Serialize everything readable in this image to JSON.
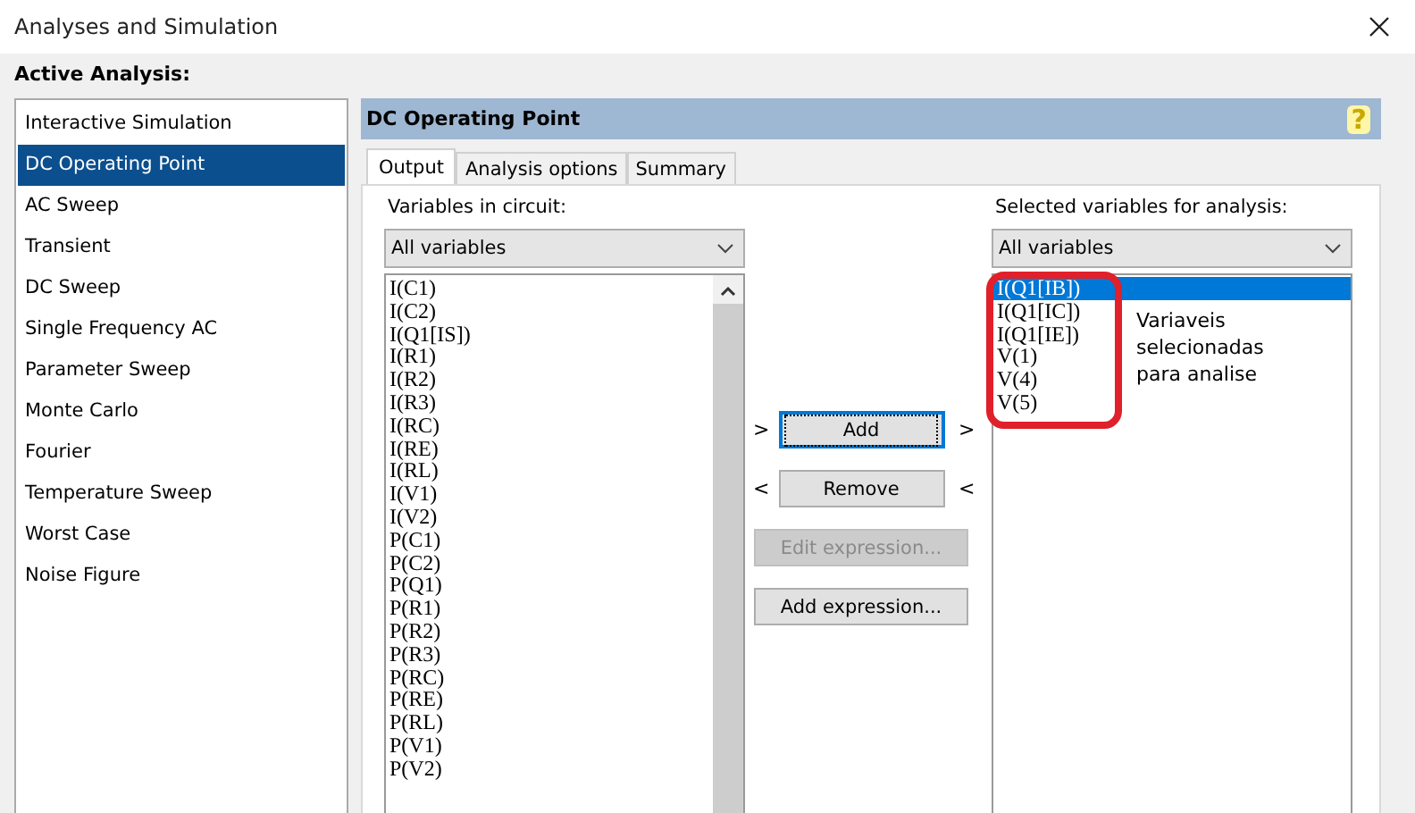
{
  "window": {
    "title": "Analyses and Simulation"
  },
  "active_analysis": {
    "label": "Active Analysis:",
    "items": [
      {
        "label": "Interactive Simulation",
        "selected": false
      },
      {
        "label": "DC Operating Point",
        "selected": true
      },
      {
        "label": "AC Sweep",
        "selected": false
      },
      {
        "label": "Transient",
        "selected": false
      },
      {
        "label": "DC Sweep",
        "selected": false
      },
      {
        "label": "Single Frequency AC",
        "selected": false
      },
      {
        "label": "Parameter Sweep",
        "selected": false
      },
      {
        "label": "Monte Carlo",
        "selected": false
      },
      {
        "label": "Fourier",
        "selected": false
      },
      {
        "label": "Temperature Sweep",
        "selected": false
      },
      {
        "label": "Worst Case",
        "selected": false
      },
      {
        "label": "Noise Figure",
        "selected": false
      }
    ]
  },
  "panel": {
    "title": "DC Operating Point",
    "help": "?"
  },
  "tabs": [
    {
      "label": "Output",
      "selected": true
    },
    {
      "label": "Analysis options",
      "selected": false
    },
    {
      "label": "Summary",
      "selected": false
    }
  ],
  "variables_in_circuit": {
    "label": "Variables in circuit:",
    "filter": "All variables",
    "items": [
      {
        "label": "I(C1)",
        "selected": false
      },
      {
        "label": "I(C2)",
        "selected": false
      },
      {
        "label": "I(Q1[IS])",
        "selected": false
      },
      {
        "label": "I(R1)",
        "selected": false
      },
      {
        "label": "I(R2)",
        "selected": false
      },
      {
        "label": "I(R3)",
        "selected": false
      },
      {
        "label": "I(RC)",
        "selected": false
      },
      {
        "label": "I(RE)",
        "selected": false
      },
      {
        "label": "I(RL)",
        "selected": false
      },
      {
        "label": "I(V1)",
        "selected": false
      },
      {
        "label": "I(V2)",
        "selected": false
      },
      {
        "label": "P(C1)",
        "selected": false
      },
      {
        "label": "P(C2)",
        "selected": false
      },
      {
        "label": "P(Q1)",
        "selected": false
      },
      {
        "label": "P(R1)",
        "selected": false
      },
      {
        "label": "P(R2)",
        "selected": false
      },
      {
        "label": "P(R3)",
        "selected": false
      },
      {
        "label": "P(RC)",
        "selected": false
      },
      {
        "label": "P(RE)",
        "selected": false
      },
      {
        "label": "P(RL)",
        "selected": false
      },
      {
        "label": "P(V1)",
        "selected": false
      },
      {
        "label": "P(V2)",
        "selected": false
      }
    ]
  },
  "buttons": [
    {
      "label": "Add",
      "disabled": false,
      "focused": true,
      "left": ">",
      "right": ">"
    },
    {
      "label": "Remove",
      "disabled": false,
      "focused": false,
      "left": "<",
      "right": "<"
    },
    {
      "label": "Edit expression...",
      "disabled": true,
      "focused": false
    },
    {
      "label": "Add expression...",
      "disabled": false,
      "focused": false
    }
  ],
  "selected_variables": {
    "label": "Selected variables for analysis:",
    "filter": "All variables",
    "items": [
      {
        "label": "I(Q1[IB])",
        "selected": true
      },
      {
        "label": "I(Q1[IC])",
        "selected": false
      },
      {
        "label": "I(Q1[IE])",
        "selected": false
      },
      {
        "label": "V(1)",
        "selected": false
      },
      {
        "label": "V(4)",
        "selected": false
      },
      {
        "label": "V(5)",
        "selected": false
      }
    ]
  },
  "annotation": {
    "text": "Variaveis selecionadas para analise"
  }
}
